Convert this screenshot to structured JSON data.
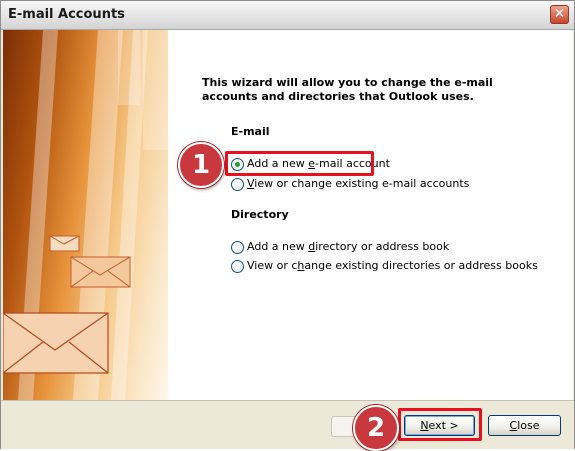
{
  "window": {
    "title": "E-mail Accounts",
    "close_glyph": "✕"
  },
  "intro": "This wizard will allow you to change the e-mail accounts and directories that Outlook uses.",
  "email_section": {
    "heading": "E-mail",
    "options": [
      {
        "pre": "Add a new ",
        "u": "e",
        "post": "-mail account",
        "selected": true
      },
      {
        "pre": "",
        "u": "V",
        "post": "iew or change existing e-mail accounts",
        "selected": false
      }
    ]
  },
  "directory_section": {
    "heading": "Directory",
    "options": [
      {
        "pre": "Add a new ",
        "u": "d",
        "post": "irectory or address book",
        "selected": false
      },
      {
        "pre": "View or c",
        "u": "h",
        "post": "ange existing directories or address books",
        "selected": false
      }
    ]
  },
  "buttons": {
    "back_label": "",
    "next": {
      "label_u": "N",
      "label_post": "ext >"
    },
    "close": {
      "label_u": "C",
      "label_post": "lose"
    }
  },
  "callouts": {
    "step1": "1",
    "step2": "2"
  },
  "colors": {
    "highlight": "#e8101e",
    "badge": "#c9383c",
    "radio_dot": "#21a121"
  }
}
